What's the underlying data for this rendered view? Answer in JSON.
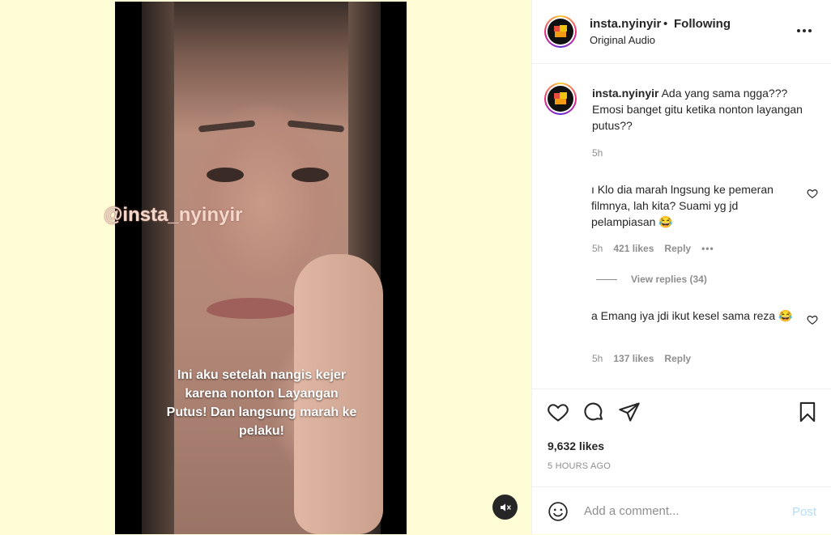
{
  "video": {
    "watermark": "@insta_nyinyir",
    "caption": "Ini aku setelah nangis kejer karena nonton Layangan Putus! Dan langsung marah ke pelaku!",
    "mute_icon": "speaker-muted-icon"
  },
  "header": {
    "username": "insta.nyinyir",
    "separator": "•",
    "follow_status": "Following",
    "audio": "Original Audio",
    "more_icon": "more-horizontal-icon"
  },
  "caption_comment": {
    "username": "insta.nyinyir",
    "text": "Ada yang sama ngga??? Emosi banget gitu ketika nonton layangan putus??",
    "time": "5h"
  },
  "comments": [
    {
      "text": "ı Klo dia marah lngsung ke pemeran filmnya, lah kita? Suami yg jd pelampiasan 😂",
      "time": "5h",
      "likes": "421 likes",
      "reply": "Reply",
      "more": "•••",
      "view_replies": "View replies (34)"
    },
    {
      "text": "a Emang iya jdi ikut kesel sama reza 😂",
      "time": "5h",
      "likes": "137 likes",
      "reply": "Reply"
    }
  ],
  "actions": {
    "like_icon": "heart-icon",
    "comment_icon": "comment-bubble-icon",
    "share_icon": "paper-plane-icon",
    "save_icon": "bookmark-icon",
    "likes_count": "9,632 likes",
    "posted_ago": "5 HOURS AGO"
  },
  "comment_box": {
    "emoji_icon": "smiley-icon",
    "placeholder": "Add a comment...",
    "post_label": "Post"
  },
  "colors": {
    "page_bg": "#fffdd6",
    "post_disabled": "#b2dffc",
    "muted_text": "#8e8e8e"
  }
}
